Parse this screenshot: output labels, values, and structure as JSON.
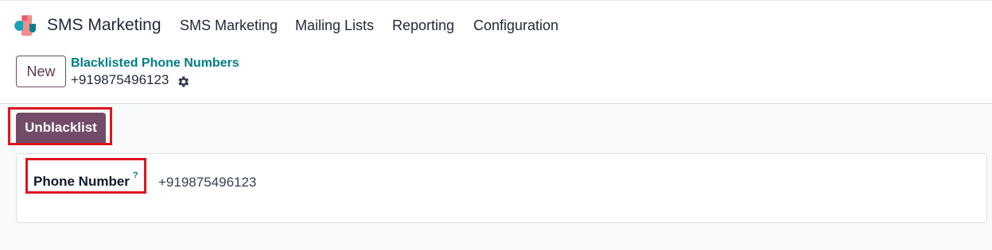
{
  "navbar": {
    "app_name": "SMS Marketing",
    "logo_icon": "sms-marketing-app-logo",
    "menu": [
      "SMS Marketing",
      "Mailing Lists",
      "Reporting",
      "Configuration"
    ]
  },
  "control_panel": {
    "new_label": "New",
    "breadcrumb_parent": "Blacklisted Phone Numbers",
    "breadcrumb_current": "+919875496123",
    "actions_icon": "gear-icon"
  },
  "statusbar": {
    "unblacklist_label": "Unblacklist"
  },
  "form": {
    "phone_label": "Phone Number",
    "help_mark": "?",
    "phone_value": "+919875496123"
  },
  "colors": {
    "primary": "#714b67",
    "link": "#017e84",
    "highlight": "#e0141e"
  }
}
